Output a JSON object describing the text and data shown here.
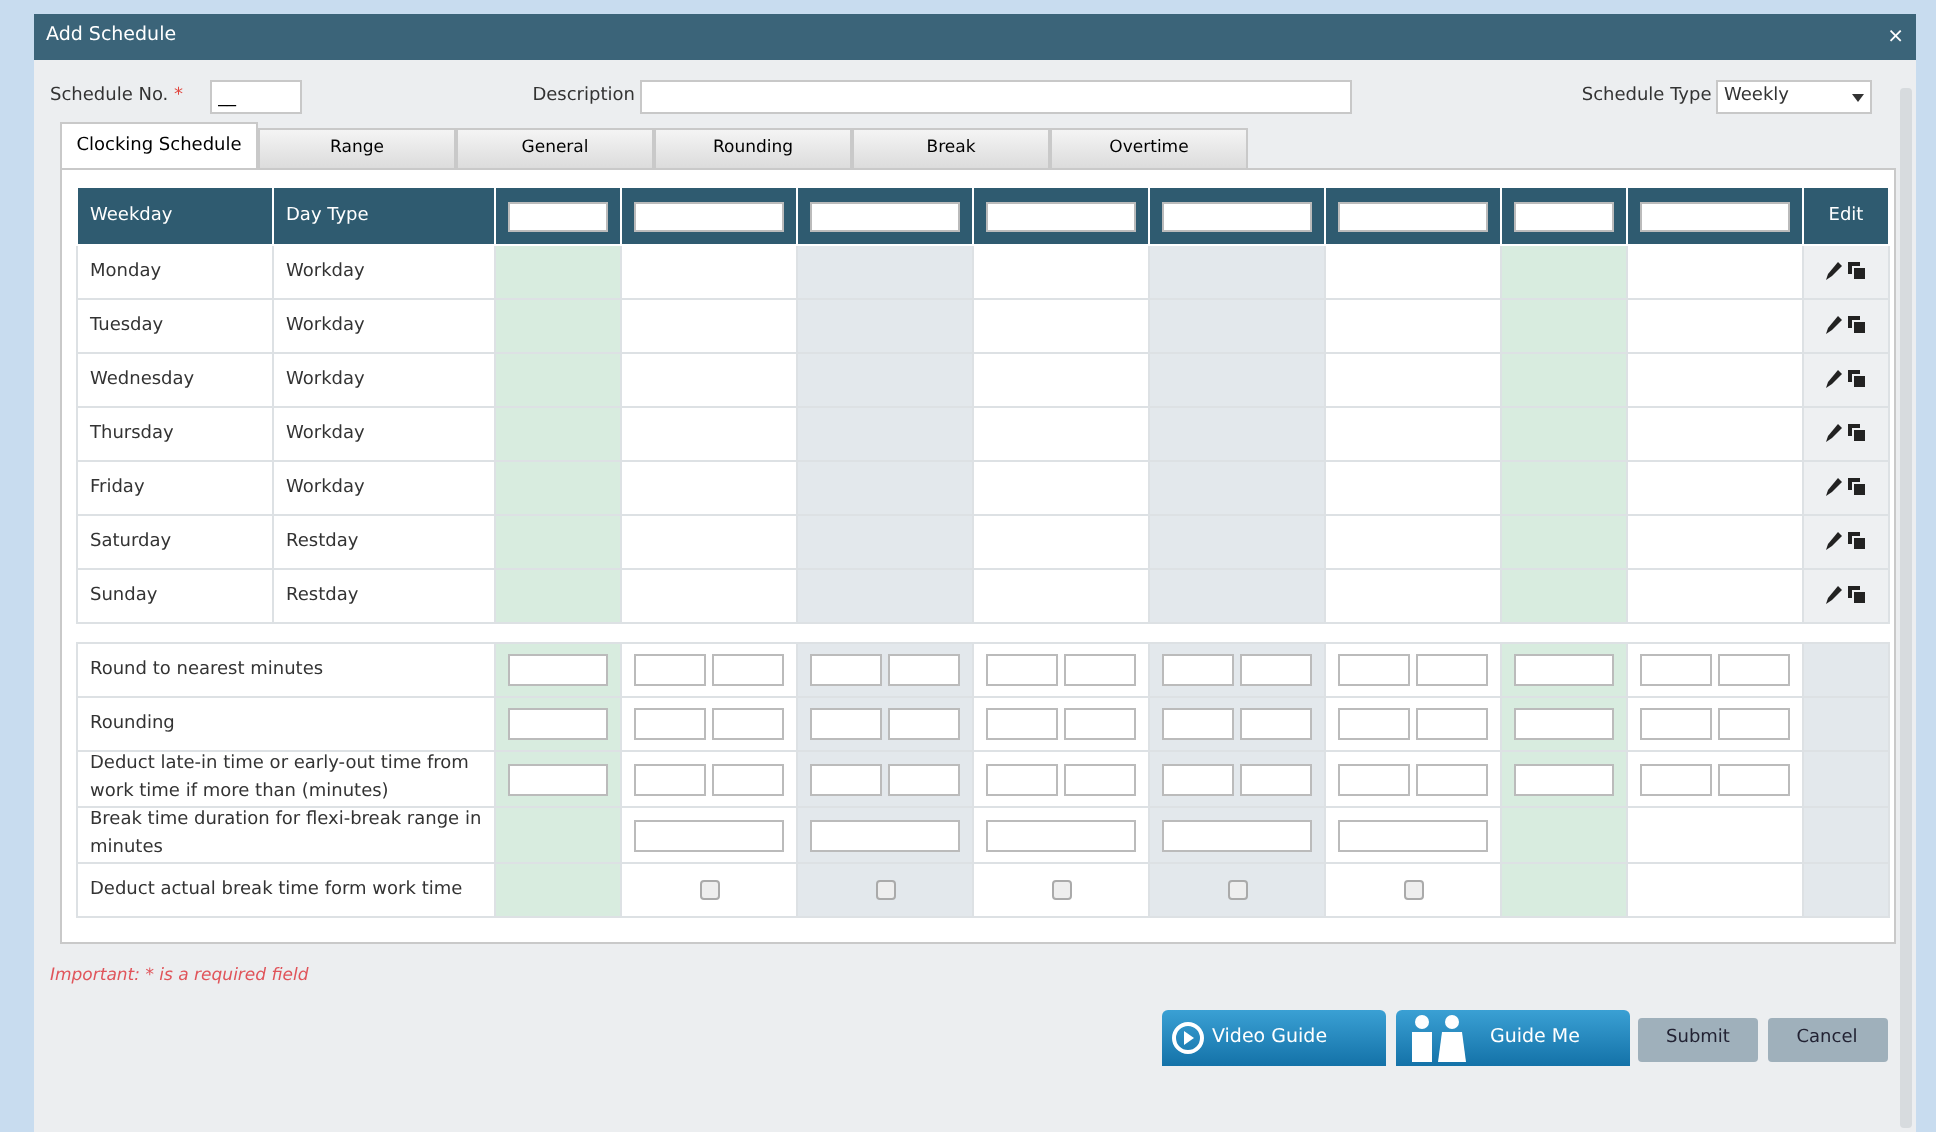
{
  "dialog": {
    "title": "Add Schedule",
    "close": "×"
  },
  "form": {
    "schedule_no": {
      "label": "Schedule No.",
      "required_mark": "*",
      "value": "__"
    },
    "description": {
      "label": "Description"
    },
    "schedule_type": {
      "label": "Schedule Type",
      "value": "Weekly"
    }
  },
  "tabs": [
    {
      "label": "Clocking Schedule",
      "selected": true
    },
    {
      "label": "Range",
      "selected": false
    },
    {
      "label": "General",
      "selected": false
    },
    {
      "label": "Rounding",
      "selected": false
    },
    {
      "label": "Break",
      "selected": false
    },
    {
      "label": "Overtime",
      "selected": false
    }
  ],
  "table": {
    "columns": [
      {
        "label": "Weekday"
      },
      {
        "label": "Day Type"
      }
    ],
    "edit_label": "Edit",
    "slots": [
      {
        "kind": "narrow",
        "color": "#d8ecdf"
      },
      {
        "kind": "wide",
        "color": "#ffffff"
      },
      {
        "kind": "wide",
        "color": "#e3e8ec"
      },
      {
        "kind": "wide",
        "color": "#ffffff"
      },
      {
        "kind": "wide",
        "color": "#e3e8ec"
      },
      {
        "kind": "wide",
        "color": "#ffffff"
      },
      {
        "kind": "narrow",
        "color": "#d8ecdf"
      },
      {
        "kind": "wide",
        "color": "#ffffff"
      }
    ],
    "rows": [
      {
        "weekday": "Monday",
        "day_type": "Workday"
      },
      {
        "weekday": "Tuesday",
        "day_type": "Workday"
      },
      {
        "weekday": "Wednesday",
        "day_type": "Workday"
      },
      {
        "weekday": "Thursday",
        "day_type": "Workday"
      },
      {
        "weekday": "Friday",
        "day_type": "Workday"
      },
      {
        "weekday": "Saturday",
        "day_type": "Restday"
      },
      {
        "weekday": "Sunday",
        "day_type": "Restday"
      }
    ]
  },
  "settings": [
    {
      "label": "Round to nearest minutes",
      "cells": [
        {
          "kind": "single"
        },
        {
          "kind": "pair"
        },
        {
          "kind": "pair"
        },
        {
          "kind": "pair"
        },
        {
          "kind": "pair"
        },
        {
          "kind": "pair"
        },
        {
          "kind": "single"
        },
        {
          "kind": "pair"
        }
      ]
    },
    {
      "label": "Rounding",
      "cells": [
        {
          "kind": "single"
        },
        {
          "kind": "pair"
        },
        {
          "kind": "pair"
        },
        {
          "kind": "pair"
        },
        {
          "kind": "pair"
        },
        {
          "kind": "pair"
        },
        {
          "kind": "single"
        },
        {
          "kind": "pair"
        }
      ]
    },
    {
      "label": "Deduct late-in time or early-out time from work time if more than (minutes)",
      "cells": [
        {
          "kind": "single"
        },
        {
          "kind": "pair"
        },
        {
          "kind": "pair"
        },
        {
          "kind": "pair"
        },
        {
          "kind": "pair"
        },
        {
          "kind": "pair"
        },
        {
          "kind": "single"
        },
        {
          "kind": "pair"
        }
      ]
    },
    {
      "label": "Break time duration for flexi-break range in minutes",
      "cells": [
        {
          "kind": "none"
        },
        {
          "kind": "wide"
        },
        {
          "kind": "wide"
        },
        {
          "kind": "wide"
        },
        {
          "kind": "wide"
        },
        {
          "kind": "wide"
        },
        {
          "kind": "none"
        },
        {
          "kind": "none"
        }
      ]
    },
    {
      "label": "Deduct actual break time form work time",
      "cells": [
        {
          "kind": "none"
        },
        {
          "kind": "checkbox",
          "checked": false
        },
        {
          "kind": "checkbox",
          "checked": false
        },
        {
          "kind": "checkbox",
          "checked": false
        },
        {
          "kind": "checkbox",
          "checked": false
        },
        {
          "kind": "checkbox",
          "checked": false
        },
        {
          "kind": "none"
        },
        {
          "kind": "none"
        }
      ]
    }
  ],
  "note": "Important: * is a required field",
  "buttons": [
    {
      "label": "Video Guide",
      "kind": "video"
    },
    {
      "label": "Guide Me",
      "kind": "guide"
    },
    {
      "label": "Submit",
      "kind": "plain"
    },
    {
      "label": "Cancel",
      "kind": "plain"
    }
  ]
}
